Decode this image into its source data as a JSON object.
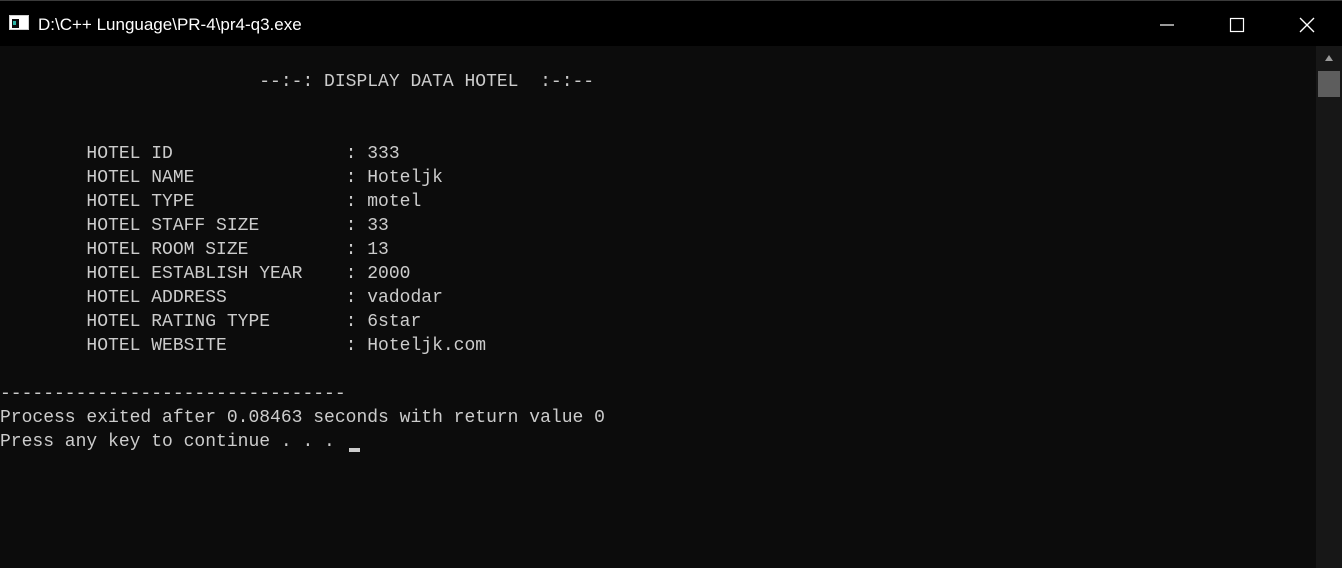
{
  "window": {
    "title": "D:\\C++ Lunguage\\PR-4\\pr4-q3.exe",
    "app_icon": "console-app-icon"
  },
  "controls": {
    "minimize_icon": "minimize-icon",
    "maximize_icon": "maximize-icon",
    "close_icon": "close-icon"
  },
  "console": {
    "heading": "                        --:-: DISPLAY DATA HOTEL  :-:--",
    "rows": [
      "        HOTEL ID                : 333",
      "        HOTEL NAME              : Hoteljk",
      "        HOTEL TYPE              : motel",
      "        HOTEL STAFF SIZE        : 33",
      "        HOTEL ROOM SIZE         : 13",
      "        HOTEL ESTABLISH YEAR    : 2000",
      "        HOTEL ADDRESS           : vadodar",
      "        HOTEL RATING TYPE       : 6star",
      "        HOTEL WEBSITE           : Hoteljk.com"
    ],
    "separator": "--------------------------------",
    "exit_message": "Process exited after 0.08463 seconds with return value 0",
    "continue_prompt": "Press any key to continue . . . "
  },
  "scrollbar": {
    "up_icon": "scroll-up-arrow-icon"
  },
  "colors": {
    "background": "#0c0c0c",
    "text": "#cccccc",
    "titlebar": "#000000"
  }
}
